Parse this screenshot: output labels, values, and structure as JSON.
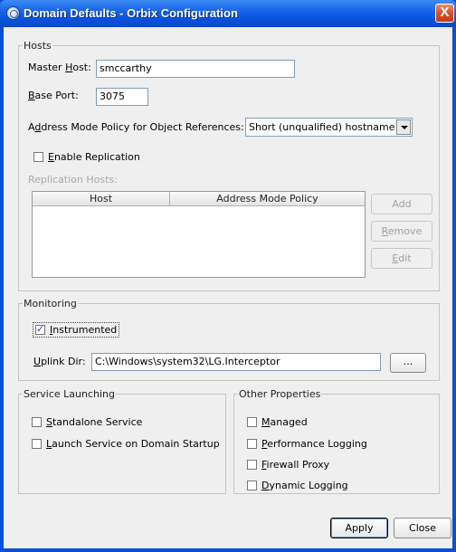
{
  "window": {
    "title": "Domain Defaults - Orbix Configuration",
    "close_label": "X"
  },
  "hosts": {
    "legend": "Hosts",
    "master_host": {
      "label_pre": "Master ",
      "label_key": "H",
      "label_post": "ost:",
      "value": "smccarthy"
    },
    "base_port": {
      "label_key": "B",
      "label_post": "ase Port:",
      "value": "3075"
    },
    "address_mode": {
      "label_pre": "A",
      "label_key": "d",
      "label_post": "dress Mode Policy for Object References:",
      "value": "Short (unqualified) hostname"
    },
    "enable_replication": {
      "label_key": "E",
      "label_post": "nable Replication",
      "checked": false
    },
    "replication_hosts_label": "Replication Hosts:",
    "table_columns": [
      "Host",
      "Address Mode Policy"
    ],
    "buttons": {
      "add": "Add",
      "remove_key": "R",
      "remove_post": "emove",
      "edit_key": "E",
      "edit_post": "dit"
    }
  },
  "monitoring": {
    "legend": "Monitoring",
    "instrumented": {
      "label_key": "I",
      "label_post": "nstrumented",
      "checked": true
    },
    "uplink_dir": {
      "label_key": "U",
      "label_post": "plink Dir:",
      "value": "C:\\Windows\\system32\\LG.Interceptor"
    },
    "browse_label": "..."
  },
  "service_launching": {
    "legend": "Service Launching",
    "standalone": {
      "label_key": "S",
      "label_post": "tandalone Service",
      "checked": false
    },
    "launch_on_startup": {
      "label_key": "L",
      "label_post": "aunch Service on Domain Startup",
      "checked": false
    }
  },
  "other_properties": {
    "legend": "Other Properties",
    "managed": {
      "label_key": "M",
      "label_post": "anaged",
      "checked": false
    },
    "performance_logging": {
      "label_key": "P",
      "label_post": "erformance Logging",
      "checked": false
    },
    "firewall_proxy": {
      "label_key": "F",
      "label_post": "irewall Proxy",
      "checked": false
    },
    "dynamic_logging": {
      "label_key": "D",
      "label_post": "ynamic Logging",
      "checked": false
    }
  },
  "footer": {
    "apply": "Apply",
    "close": "Close"
  }
}
